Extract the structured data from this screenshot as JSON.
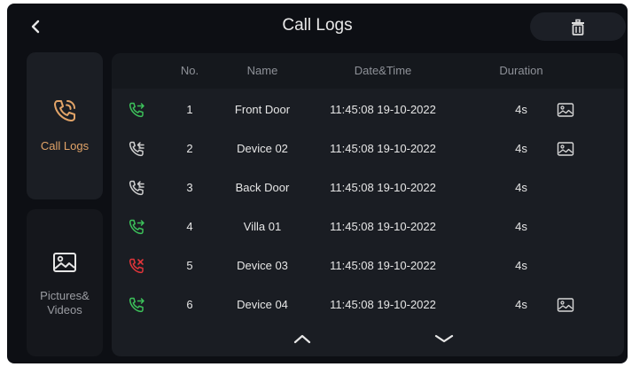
{
  "header": {
    "title": "Call Logs"
  },
  "sidebar": {
    "call_logs_label": "Call Logs",
    "pictures_label_line1": "Pictures&",
    "pictures_label_line2": "Videos"
  },
  "table": {
    "headers": {
      "no": "No.",
      "name": "Name",
      "datetime": "Date&Time",
      "duration": "Duration"
    },
    "rows": [
      {
        "type": "incoming-answered",
        "no": "1",
        "name": "Front Door",
        "datetime": "11:45:08 19-10-2022",
        "duration": "4s",
        "has_picture": true
      },
      {
        "type": "outgoing",
        "no": "2",
        "name": "Device 02",
        "datetime": "11:45:08 19-10-2022",
        "duration": "4s",
        "has_picture": true
      },
      {
        "type": "outgoing",
        "no": "3",
        "name": "Back Door",
        "datetime": "11:45:08 19-10-2022",
        "duration": "4s",
        "has_picture": false
      },
      {
        "type": "incoming-answered",
        "no": "4",
        "name": "Villa 01",
        "datetime": "11:45:08 19-10-2022",
        "duration": "4s",
        "has_picture": false
      },
      {
        "type": "missed",
        "no": "5",
        "name": "Device 03",
        "datetime": "11:45:08 19-10-2022",
        "duration": "4s",
        "has_picture": false
      },
      {
        "type": "incoming-answered",
        "no": "6",
        "name": "Device 04",
        "datetime": "11:45:08 19-10-2022",
        "duration": "4s",
        "has_picture": true
      }
    ]
  },
  "colors": {
    "accent": "#e2a468",
    "answered": "#3cc15a",
    "missed": "#e0353a",
    "outgoing": "#d0d0d0"
  },
  "icons": {
    "back": "chevron-left-icon",
    "delete": "trash-icon",
    "call_logs": "phone-call-icon",
    "pictures": "image-icon",
    "page_up": "chevron-up-icon",
    "page_down": "chevron-down-icon"
  }
}
